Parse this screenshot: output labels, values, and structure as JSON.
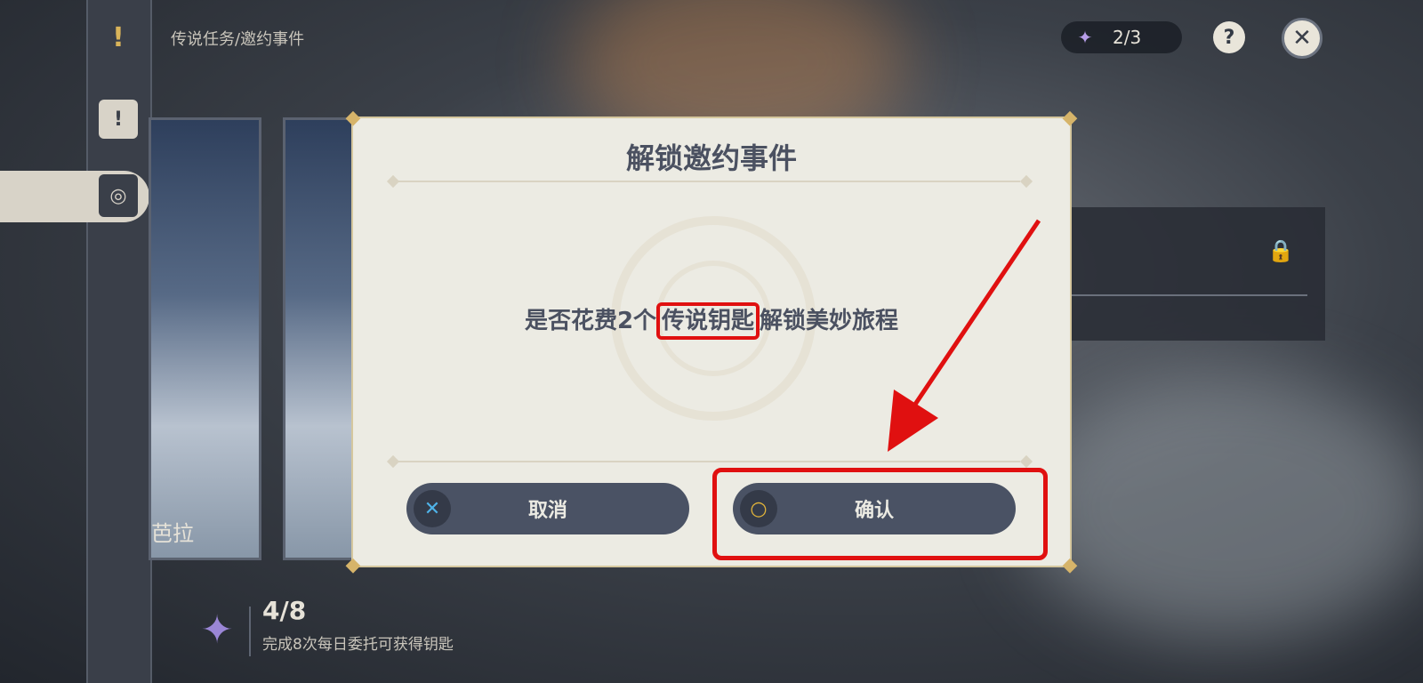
{
  "breadcrumb": "传说任务/邀约事件",
  "key_counter": {
    "icon": "legend-key-icon",
    "value": "2/3"
  },
  "help_label": "?",
  "close_icon": "close-icon",
  "sidebar": {
    "items": [
      {
        "icon": "exclamation-icon"
      },
      {
        "icon": "quest-book-icon"
      },
      {
        "icon": "invitation-icon",
        "active": true
      }
    ]
  },
  "cards": [
    {
      "name": "芭拉"
    },
    {
      "name": ""
    }
  ],
  "footer": {
    "count": "4/8",
    "hint": "完成8次每日委托可获得钥匙"
  },
  "dialog": {
    "title": "解锁邀约事件",
    "message_prefix": "是否花费2个",
    "message_highlight": "传说钥匙",
    "message_suffix": "解锁美妙旅程",
    "cancel_label": "取消",
    "confirm_label": "确认",
    "cancel_icon": "cross-icon",
    "confirm_icon": "circle-icon"
  },
  "colors": {
    "accent_red": "#e01010",
    "dialog_bg": "#ecebe3",
    "button_bg": "#4a5264"
  }
}
